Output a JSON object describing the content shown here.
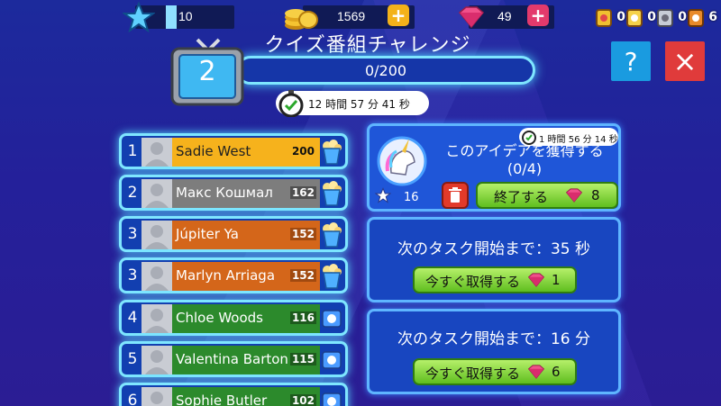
{
  "top": {
    "stars": "10",
    "coins": "1569",
    "gems": "49",
    "badges": [
      "0",
      "0",
      "0",
      "6"
    ]
  },
  "header": {
    "episode": "2",
    "title": "クイズ番組チャレンジ",
    "progress": "0/200",
    "progress_fraction": 0,
    "timer": "12 時間 57 分 41 秒"
  },
  "buttons": {
    "help": "?",
    "close": "×"
  },
  "leaderboard": [
    {
      "rank": "1",
      "name": "Sadie West",
      "score": "200",
      "color": "#f6b21c",
      "score_bg": "#f6b21c",
      "score_color": "#111"
    },
    {
      "rank": "2",
      "name": "Макс Кошмал",
      "score": "162",
      "color": "#7d7d7d",
      "score_bg": "#4f4f4f",
      "score_color": "#fff"
    },
    {
      "rank": "3",
      "name": "Júpiter Ya",
      "score": "152",
      "color": "#d4661a",
      "score_bg": "#a14a10",
      "score_color": "#fff"
    },
    {
      "rank": "3",
      "name": "Marlyn Arriaga",
      "score": "152",
      "color": "#d4661a",
      "score_bg": "#a14a10",
      "score_color": "#fff"
    },
    {
      "rank": "4",
      "name": "Chloe Woods",
      "score": "116",
      "color": "#2c8a2c",
      "score_bg": "#1d5a1d",
      "score_color": "#fff"
    },
    {
      "rank": "5",
      "name": "Valentina Barton",
      "score": "115",
      "color": "#2c8a2c",
      "score_bg": "#1d5a1d",
      "score_color": "#fff"
    },
    {
      "rank": "6",
      "name": "Sophie Butler",
      "score": "102",
      "color": "#2c8a2c",
      "score_bg": "#1d5a1d",
      "score_color": "#fff"
    }
  ],
  "task": {
    "timer": "1 時間 56 分 14 秒",
    "text": "このアイデアを獲得する (0/4)",
    "stars": "16",
    "finish_label": "終了する",
    "finish_cost": "8"
  },
  "next1": {
    "text": "次のタスク開始まで：35 秒",
    "button": "今すぐ取得する",
    "cost": "1"
  },
  "next2": {
    "text": "次のタスク開始まで：16 分",
    "button": "今すぐ取得する",
    "cost": "6"
  },
  "colors": {
    "accent": "#7fe6ff",
    "help": "#1a9be0",
    "close": "#e03b3b"
  }
}
